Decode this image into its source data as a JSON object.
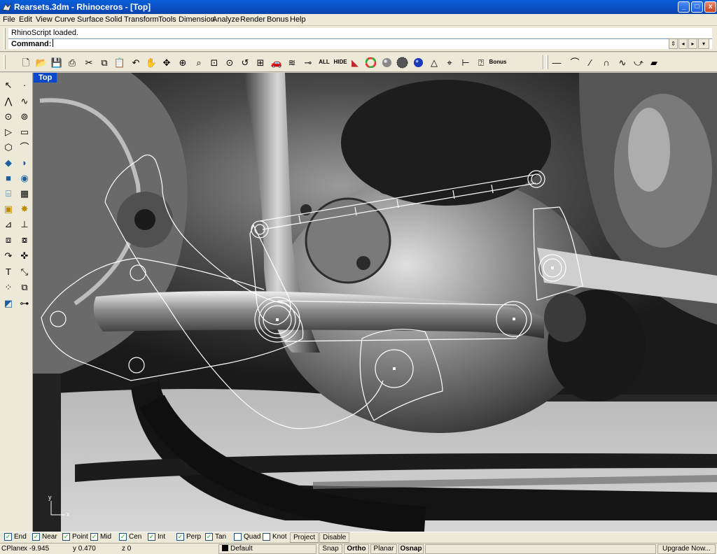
{
  "window": {
    "title": "Rearsets.3dm - Rhinoceros - [Top]",
    "minimize_glyph": "_",
    "maximize_glyph": "□",
    "close_glyph": "x"
  },
  "menu": [
    "File",
    "Edit",
    "View",
    "Curve",
    "Surface",
    "Solid",
    "Transform",
    "Tools",
    "Dimension",
    "Analyze",
    "Render",
    "Bonus",
    "Help"
  ],
  "command": {
    "history": "RhinoScript loaded.",
    "prompt": "Command:",
    "value": ""
  },
  "toolbar": {
    "all_label": "ALL",
    "hide_label": "HIDE",
    "bonus_label": "Bonus",
    "icons": [
      "new-file-icon",
      "open-icon",
      "save-icon",
      "print-icon",
      "cut-icon",
      "copy-icon",
      "paste-icon",
      "undo-icon",
      "pan-hand-icon",
      "rotate-view-icon",
      "zoom-icon",
      "zoom-window-icon",
      "zoom-extents-icon",
      "zoom-selected-icon",
      "zoom-previous-icon",
      "four-viewports-icon",
      "car-icon",
      "layers-icon",
      "show-objects-icon",
      "lock-icon",
      "shade-icon",
      "color-wheel-icon",
      "sphere-icon",
      "render-sphere-icon",
      "blue-sphere-icon",
      "light-icon",
      "osnap-icon",
      "dimension-icon",
      "help-icon",
      "line-icon",
      "polyline-icon",
      "curve-icon",
      "arc-icon",
      "circle-icon",
      "surface-icon"
    ]
  },
  "viewport": {
    "title": "Top",
    "axis_x": "x",
    "axis_y": "y"
  },
  "osnaps": [
    {
      "label": "End",
      "checked": true
    },
    {
      "label": "Near",
      "checked": true
    },
    {
      "label": "Point",
      "checked": true
    },
    {
      "label": "Mid",
      "checked": true
    },
    {
      "label": "Cen",
      "checked": true
    },
    {
      "label": "Int",
      "checked": true
    },
    {
      "label": "Perp",
      "checked": true
    },
    {
      "label": "Tan",
      "checked": true
    },
    {
      "label": "Quad",
      "checked": false
    },
    {
      "label": "Knot",
      "checked": false
    }
  ],
  "osnap_buttons": {
    "project": "Project",
    "disable": "Disable"
  },
  "status": {
    "cplane": "CPlane",
    "x": "x -9.945",
    "y": "y 0.470",
    "z": "z 0",
    "layer": "Default",
    "snap": "Snap",
    "ortho": "Ortho",
    "planar": "Planar",
    "osnap": "Osnap",
    "upgrade": "Upgrade Now..."
  },
  "colors": {
    "titlebar": "#0b4fc4",
    "chrome": "#ece9d8",
    "viewport_label": "#0b48c9",
    "curves": "#ffffff"
  }
}
